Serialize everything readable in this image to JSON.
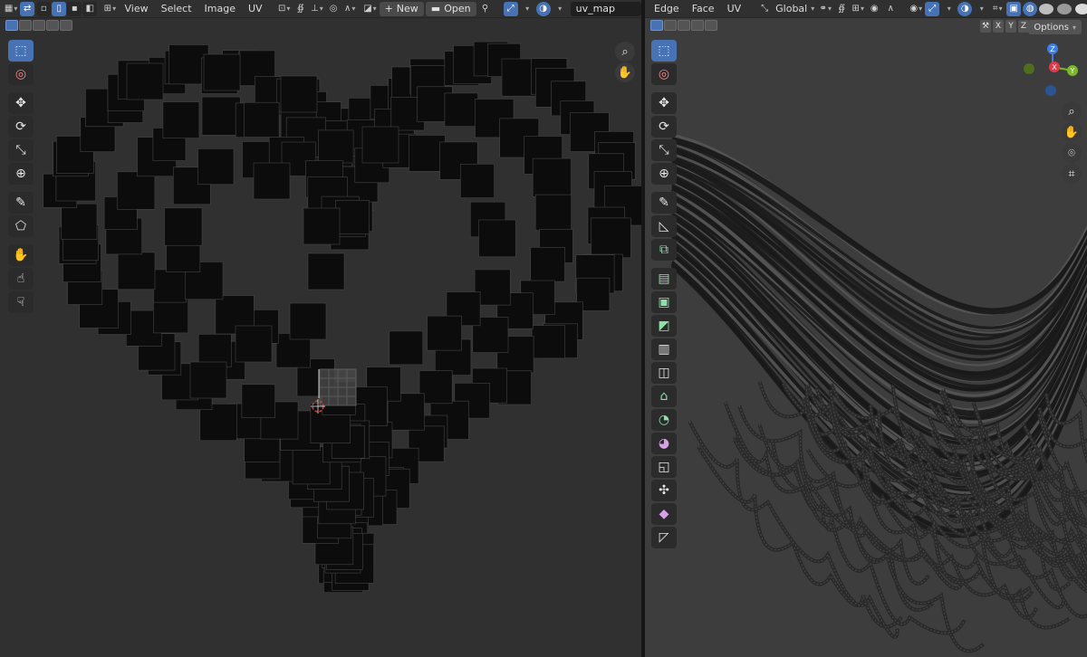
{
  "uv_editor": {
    "menus": [
      "View",
      "Select",
      "Image",
      "UV"
    ],
    "new_label": "New",
    "open_label": "Open",
    "image_name": "uv_map"
  },
  "viewport": {
    "menus": [
      "Edge",
      "Face",
      "UV"
    ],
    "transform_orientation": "Global",
    "axis_labels": [
      "X",
      "Y",
      "Z"
    ],
    "options_label": "Options",
    "gizmo_axes": {
      "x": "X",
      "y": "Y",
      "z": "Z"
    }
  },
  "colors": {
    "accent": "#4772b3",
    "panel_bg": "#303030",
    "viewport_bg": "#3d3d3d",
    "gizmo_x": "#e2394a",
    "gizmo_y": "#7ab829",
    "gizmo_z": "#3d7ee0"
  }
}
